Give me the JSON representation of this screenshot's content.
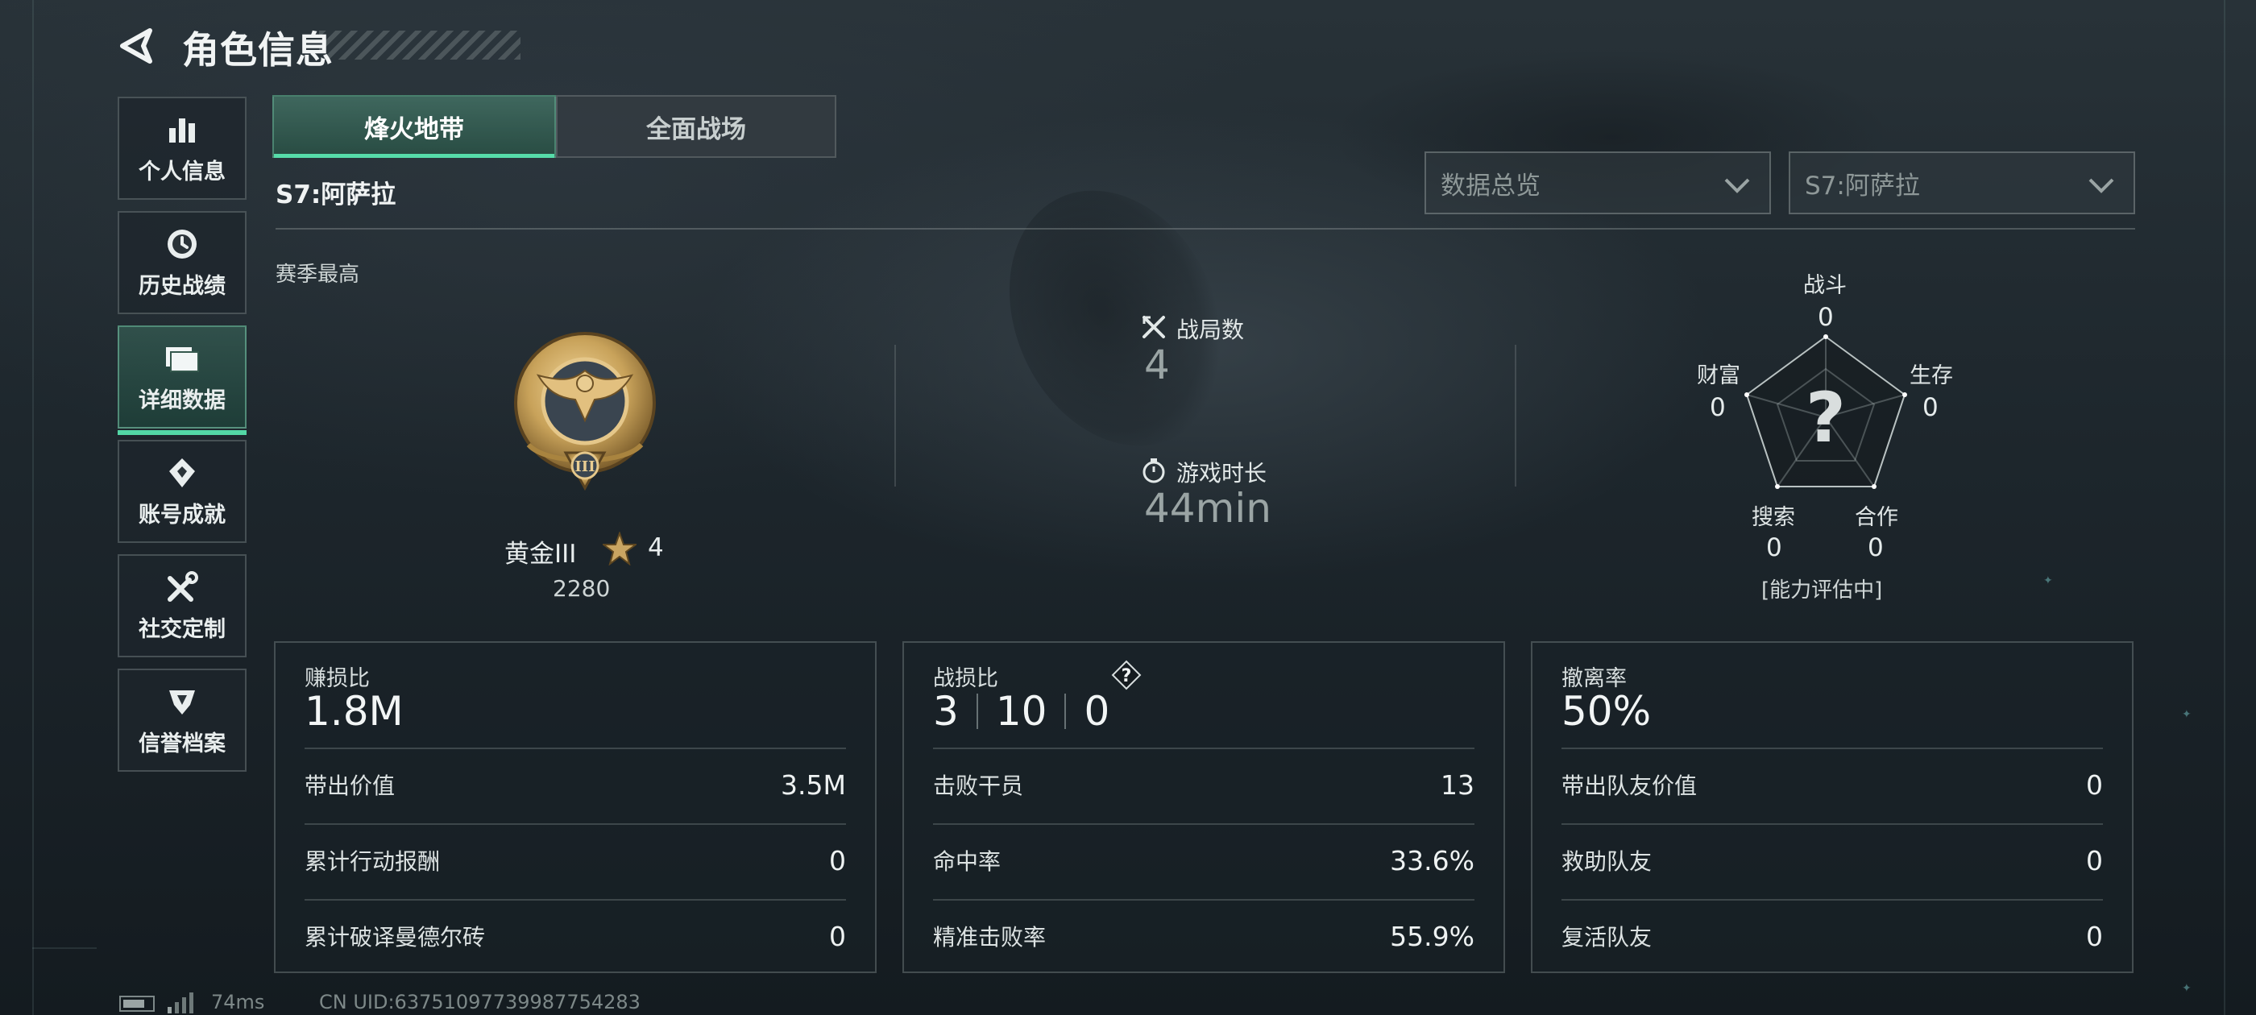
{
  "header": {
    "title": "角色信息"
  },
  "sidebar": {
    "items": [
      {
        "label": "个人信息",
        "icon": "bar-chart-icon"
      },
      {
        "label": "历史战绩",
        "icon": "history-icon"
      },
      {
        "label": "详细数据",
        "icon": "folder-icon",
        "active": true
      },
      {
        "label": "账号成就",
        "icon": "achievement-icon"
      },
      {
        "label": "社交定制",
        "icon": "tools-icon"
      },
      {
        "label": "信誉档案",
        "icon": "shield-icon"
      }
    ]
  },
  "tabs": [
    {
      "label": "烽火地带",
      "active": true
    },
    {
      "label": "全面战场",
      "active": false
    }
  ],
  "season": "S7:阿萨拉",
  "filters": {
    "view_select": "数据总览",
    "season_select": "S7:阿萨拉"
  },
  "season_best": "赛季最高",
  "rank": {
    "name": "黄金III",
    "stars": "4",
    "score": "2280",
    "medal_numeral": "III"
  },
  "matches": {
    "label": "战局数",
    "value": "4"
  },
  "playtime": {
    "label": "游戏时长",
    "value": "44min"
  },
  "radar": {
    "center": "?",
    "axes": [
      {
        "label": "战斗",
        "value": "0"
      },
      {
        "label": "生存",
        "value": "0"
      },
      {
        "label": "合作",
        "value": "0"
      },
      {
        "label": "搜索",
        "value": "0"
      },
      {
        "label": "财富",
        "value": "0"
      }
    ],
    "status": "[能力评估中]"
  },
  "panels": {
    "profit": {
      "title": "赚损比",
      "main": "1.8M",
      "rows": [
        {
          "label": "带出价值",
          "value": "3.5M"
        },
        {
          "label": "累计行动报酬",
          "value": "0"
        },
        {
          "label": "累计破译曼德尔砖",
          "value": "0"
        }
      ]
    },
    "kd": {
      "title": "战损比",
      "help": "?",
      "kills": "3",
      "deaths": "10",
      "assists": "0",
      "rows": [
        {
          "label": "击败干员",
          "value": "13"
        },
        {
          "label": "命中率",
          "value": "33.6%"
        },
        {
          "label": "精准击败率",
          "value": "55.9%"
        }
      ]
    },
    "extract": {
      "title": "撤离率",
      "main": "50%",
      "rows": [
        {
          "label": "带出队友价值",
          "value": "0"
        },
        {
          "label": "救助队友",
          "value": "0"
        },
        {
          "label": "复活队友",
          "value": "0"
        }
      ]
    }
  },
  "footer": {
    "ping": "74ms",
    "uid": "CN UID:637510977399877542​83"
  },
  "colors": {
    "accent": "#53d7a6",
    "gold": "#c8a25a"
  }
}
